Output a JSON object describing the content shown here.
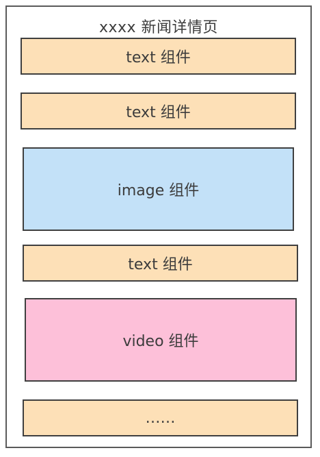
{
  "page": {
    "title": "xxxx 新闻详情页"
  },
  "blocks": [
    {
      "label": "text 组件",
      "color": "#fde0b7"
    },
    {
      "label": "text 组件",
      "color": "#fde0b7"
    },
    {
      "label": "image 组件",
      "color": "#c3e1f8"
    },
    {
      "label": "text 组件",
      "color": "#fde0b7"
    },
    {
      "label": "video 组件",
      "color": "#fdc0d9"
    },
    {
      "label": "……",
      "color": "#fde0b7"
    }
  ]
}
